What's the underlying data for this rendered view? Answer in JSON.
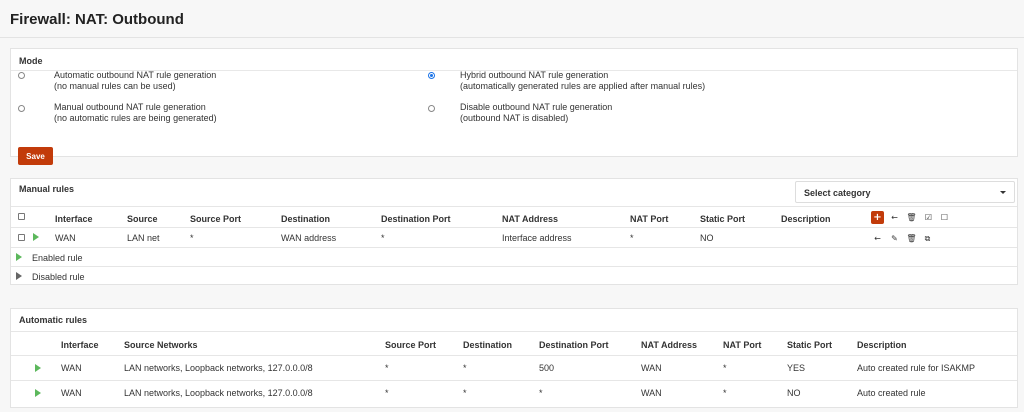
{
  "page": {
    "title": "Firewall: NAT: Outbound"
  },
  "mode": {
    "heading": "Mode",
    "options": [
      {
        "title": "Automatic outbound NAT rule generation",
        "subtitle": "(no manual rules can be used)",
        "checked": false
      },
      {
        "title": "Hybrid outbound NAT rule generation",
        "subtitle": "(automatically generated rules are applied after manual rules)",
        "checked": true
      },
      {
        "title": "Manual outbound NAT rule generation",
        "subtitle": "(no automatic rules are being generated)",
        "checked": false
      },
      {
        "title": "Disable outbound NAT rule generation",
        "subtitle": "(outbound NAT is disabled)",
        "checked": false
      }
    ],
    "save_label": "Save"
  },
  "manual": {
    "heading": "Manual rules",
    "category_select": "Select category",
    "headers": [
      "Interface",
      "Source",
      "Source Port",
      "Destination",
      "Destination Port",
      "NAT Address",
      "NAT Port",
      "Static Port",
      "Description"
    ],
    "rows": [
      {
        "interface": "WAN",
        "source": "LAN net",
        "source_port": "*",
        "destination": "WAN address",
        "destination_port": "*",
        "nat_address": "Interface address",
        "nat_port": "*",
        "static_port": "NO",
        "description": ""
      }
    ],
    "legend": {
      "enabled": "Enabled rule",
      "disabled": "Disabled rule"
    },
    "header_icons": [
      "add-icon",
      "arrow-left-icon",
      "trash-icon",
      "check-square-icon",
      "square-icon"
    ],
    "row_icons": [
      "arrow-left-icon",
      "pencil-icon",
      "trash-icon",
      "clone-icon"
    ]
  },
  "automatic": {
    "heading": "Automatic rules",
    "headers": [
      "Interface",
      "Source Networks",
      "Source Port",
      "Destination",
      "Destination Port",
      "NAT Address",
      "NAT Port",
      "Static Port",
      "Description"
    ],
    "rows": [
      {
        "interface": "WAN",
        "source_networks": "LAN networks, Loopback networks, 127.0.0.0/8",
        "source_port": "*",
        "destination": "*",
        "destination_port": "500",
        "nat_address": "WAN",
        "nat_port": "*",
        "static_port": "YES",
        "description": "Auto created rule for ISAKMP"
      },
      {
        "interface": "WAN",
        "source_networks": "LAN networks, Loopback networks, 127.0.0.0/8",
        "source_port": "*",
        "destination": "*",
        "destination_port": "*",
        "nat_address": "WAN",
        "nat_port": "*",
        "static_port": "NO",
        "description": "Auto created rule"
      }
    ]
  },
  "colors": {
    "accent": "#c23b0a",
    "enabled": "#5cb85c",
    "disabled": "#666666",
    "radio": "#1a73e8"
  }
}
